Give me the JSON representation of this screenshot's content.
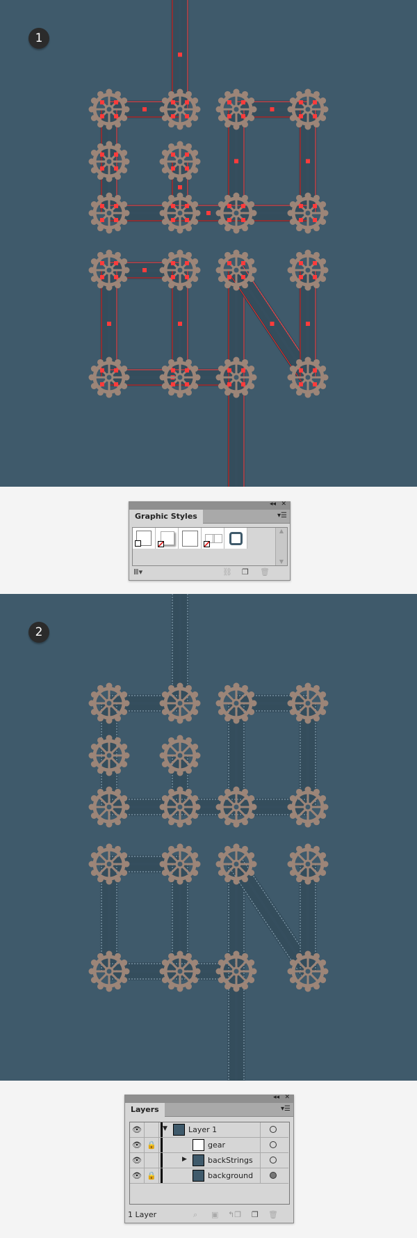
{
  "steps": [
    {
      "label": "1"
    },
    {
      "label": "2"
    }
  ],
  "graphic_styles": {
    "title": "Graphic Styles",
    "collapse_icon": "double-chevron-left-icon",
    "close_icon": "close-icon",
    "menu_icon": "panel-menu-icon",
    "swatch_count": 5,
    "footer_icons": [
      "library-icon",
      "break-link-icon",
      "new-style-icon",
      "trash-icon"
    ]
  },
  "layers": {
    "title": "Layers",
    "rows": [
      {
        "name": "Layer 1",
        "visible": true,
        "locked": false,
        "expanded": true,
        "indent": 0
      },
      {
        "name": "gear",
        "visible": true,
        "locked": true,
        "expanded": false,
        "indent": 1
      },
      {
        "name": "backStrings",
        "visible": true,
        "locked": false,
        "expanded": false,
        "has_children": true,
        "indent": 1
      },
      {
        "name": "background",
        "visible": true,
        "locked": true,
        "expanded": false,
        "indent": 1
      }
    ],
    "status": "1 Layer",
    "footer_icons": [
      "locate-object-icon",
      "make-clipping-mask-icon",
      "new-sublayer-icon",
      "new-layer-icon",
      "trash-icon"
    ]
  },
  "colors": {
    "background": "#3f5a6b",
    "gear": "#9c8578",
    "selection": "#ff3b3b",
    "stitch": "#a9c3d2"
  }
}
